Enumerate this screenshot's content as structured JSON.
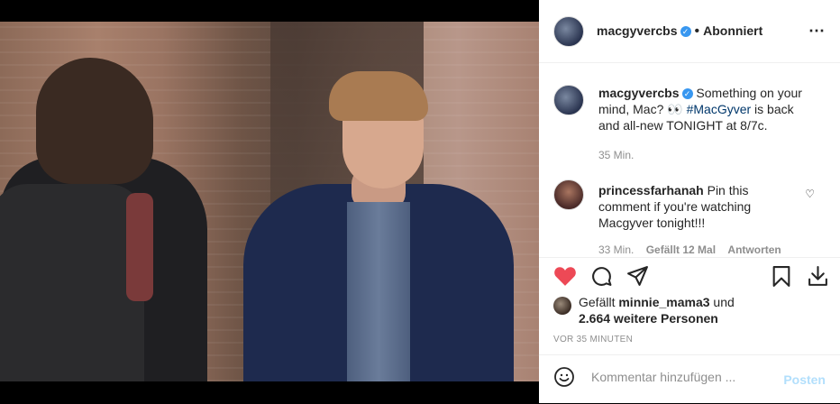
{
  "post": {
    "username": "macgyvercbs",
    "follow_status": "Abonniert",
    "more_icon": "⋯"
  },
  "caption": {
    "username": "macgyvercbs",
    "text_before": "Something on your mind, Mac? 👀 ",
    "hashtag": "#MacGyver",
    "text_after": " is back and all-new TONIGHT at 8/7c.",
    "time": "35 Min."
  },
  "comment": {
    "username": "princessfarhanah",
    "text": "Pin this comment if you're watching Macgyver tonight!!!",
    "time": "33 Min.",
    "likes": "Gefällt 12 Mal",
    "reply": "Antworten"
  },
  "likes": {
    "prefix": "Gefällt ",
    "user": "minnie_mama3",
    "middle": " und",
    "others": "2.664 weitere Personen"
  },
  "timestamp": "VOR 35 MINUTEN",
  "add_comment": {
    "placeholder": "Kommentar hinzufügen ...",
    "post_label": "Posten"
  },
  "colors": {
    "like_red": "#ed4956",
    "link": "#00376b",
    "verified": "#3897f0",
    "post_disabled": "#b2dffc"
  }
}
